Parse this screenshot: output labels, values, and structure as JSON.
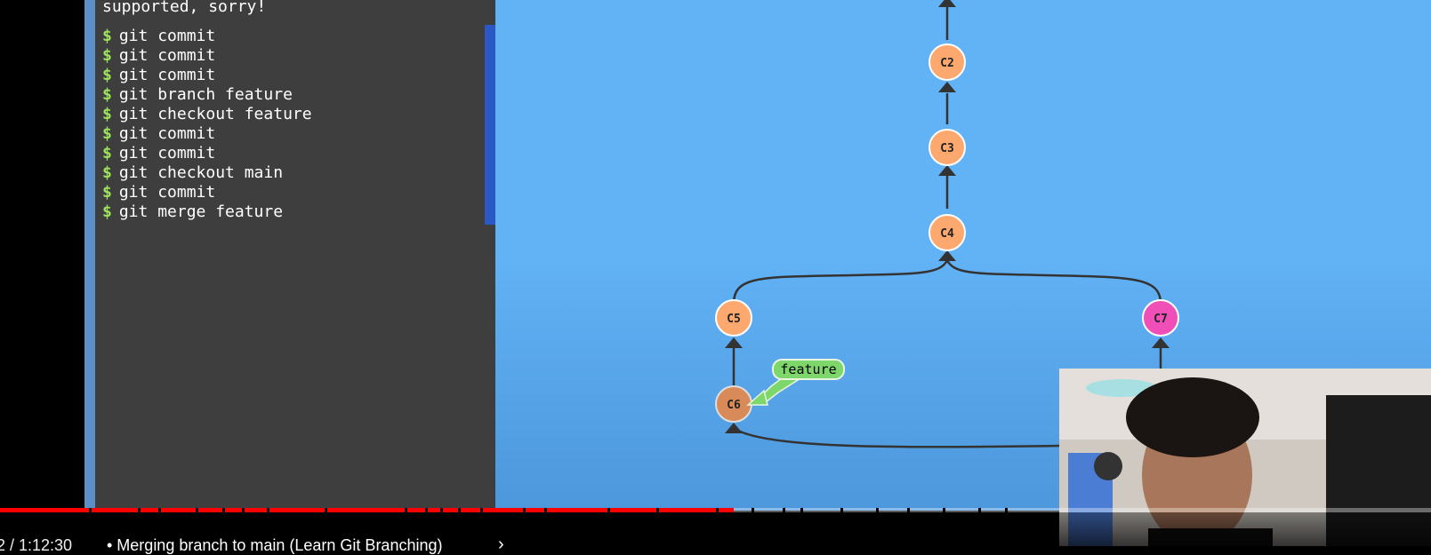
{
  "terminal": {
    "error_text": "supported, sorry!",
    "prompt": "$",
    "commands": [
      "git commit",
      "git commit",
      "git commit",
      "git branch feature",
      "git checkout feature",
      "git commit",
      "git commit",
      "git checkout main",
      "git commit",
      "git merge feature"
    ],
    "status_icon": "checkbox-checked-icon",
    "colors": {
      "prompt": "#9ee35a",
      "done_band": "#2b58c4",
      "background": "#3e3e3e"
    }
  },
  "graph": {
    "nodes": [
      "C2",
      "C3",
      "C4",
      "C5",
      "C6",
      "C7"
    ],
    "branch_label": "feature",
    "colors": {
      "commit": "#fda86f",
      "head_commit": "#d88a59",
      "other_branch_commit": "#f04fb8",
      "branch_tag": "#7ed76a",
      "background": "#62b2f6"
    }
  },
  "player": {
    "time_text": "2 / 1:12:30",
    "chapter_title": "• Merging branch to main (Learn Git Branching)",
    "chapter_chevron": "›",
    "progress": 0.513,
    "colors": {
      "progress": "#ff0000"
    }
  }
}
